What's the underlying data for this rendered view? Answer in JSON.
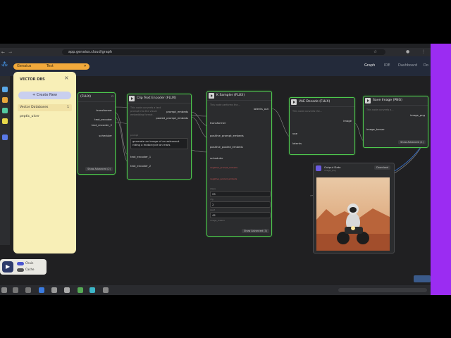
{
  "browser": {
    "url": "app.genaius.cloud/graph"
  },
  "appbar": {
    "project_selector": "Genaius",
    "run_name": "Test",
    "nav": [
      "Graph",
      "IDE",
      "Dashboard",
      "Do"
    ]
  },
  "vector_panel": {
    "title": "VECTOR DBS",
    "create_button": "+ Create New",
    "section_label": "Vector Databases",
    "section_count": "1",
    "items": [
      "peptic_ulcer"
    ]
  },
  "bottom_controls": {
    "chain_label": "Chain",
    "cache_label": "Cache"
  },
  "nodes": {
    "loader": {
      "title": "(FLUX)",
      "outputs": [
        "transformer",
        "text_encoder",
        "text_encoder_2",
        "scheduler"
      ],
      "button": "Show Advanced (2)"
    },
    "clip": {
      "title": "Clip Text Encoder (FLUX)",
      "desc": "This node converts a text prompt into the visual embedding format.",
      "outputs": [
        "prompt_embeds",
        "pooled_prompt_embeds"
      ],
      "input_label": "prompt",
      "prompt_text": "generate an image of an astronaut riding a motorcycle on mars",
      "inputs": [
        "text_encoder_1",
        "text_encoder_2"
      ]
    },
    "ksampler": {
      "title": "K Sampler (FLUX)",
      "desc": "This node performs the...",
      "output": "latents_out",
      "inputs": [
        "transformer",
        "positive_prompt_embeds",
        "positive_pooled_embeds",
        "scheduler",
        "negative_prompt_embeds",
        "negative_pooled_embeds",
        "steps",
        "cfg",
        "seed",
        "image_tokens"
      ],
      "steps_value": "25",
      "cfg_value": "2",
      "seed_value": "42",
      "button": "Show Advanced (3)"
    },
    "vae": {
      "title": "VAE Decode (FLUX)",
      "desc": "This node converts the...",
      "output": "image",
      "inputs": [
        "vae",
        "latents"
      ]
    },
    "save": {
      "title": "Save Image (PNG)",
      "desc": "This node converts a...",
      "output": "image_png",
      "input": "image_tensor",
      "button": "Show Advanced (1)"
    },
    "output": {
      "title": "Output Data",
      "subtitle": "image_png",
      "download": "Download"
    }
  },
  "colors": {
    "accent_green": "#4ec84e",
    "panel_yellow": "#f8efb7",
    "pill_orange": "#f2a93b",
    "right_bar": "#9b2cf2"
  }
}
